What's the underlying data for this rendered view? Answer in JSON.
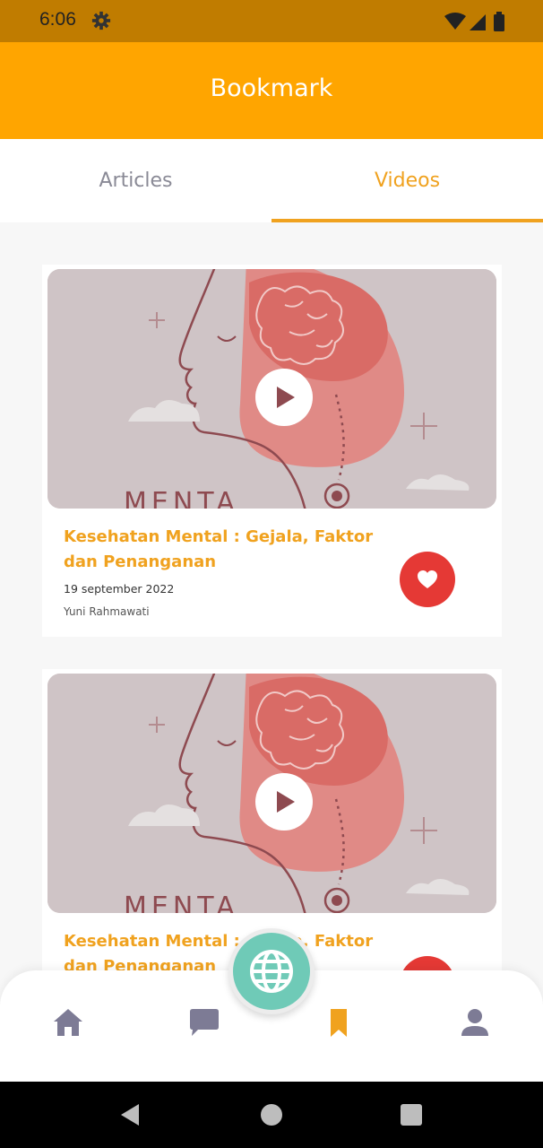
{
  "status_bar": {
    "time": "6:06",
    "icons": [
      "gear-icon",
      "wifi-icon",
      "signal-icon",
      "battery-icon"
    ]
  },
  "header": {
    "title": "Bookmark",
    "background": "#ffa500"
  },
  "tabs": [
    {
      "label": "Articles",
      "active": false
    },
    {
      "label": "Videos",
      "active": true
    }
  ],
  "accent_color": "#f0a21f",
  "videos": [
    {
      "thumbnail_text": "MENTA",
      "title": "Kesehatan Mental : Gejala, Faktor dan Penanganan",
      "date": "19 september 2022",
      "author": "Yuni Rahmawati",
      "favorited": true
    },
    {
      "thumbnail_text": "MENTA",
      "title": "Kesehatan Mental : Gejala, Faktor dan Penanganan"
    }
  ],
  "bottom_nav": {
    "items": [
      {
        "icon": "home-icon",
        "active": false
      },
      {
        "icon": "chat-icon",
        "active": false
      },
      {
        "icon": "bookmark-icon",
        "active": true
      },
      {
        "icon": "profile-icon",
        "active": false
      }
    ],
    "fab_icon": "globe-icon"
  },
  "system_nav": [
    "back-icon",
    "home-circle-icon",
    "recents-icon"
  ]
}
